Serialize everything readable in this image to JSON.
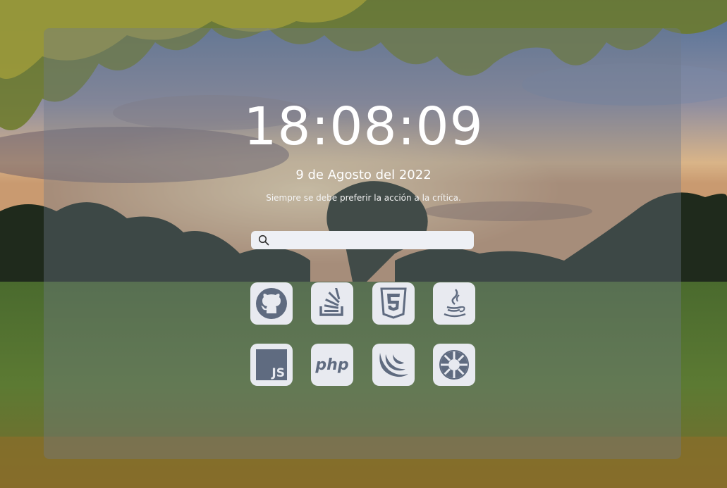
{
  "clock": {
    "time": "18:08:09"
  },
  "date": {
    "text": "9 de Agosto del 2022"
  },
  "quote": {
    "text": "Siempre se debe preferir la acción a la crítica."
  },
  "search": {
    "placeholder": "",
    "value": ""
  },
  "shortcuts": [
    {
      "name": "github",
      "icon": "github-icon"
    },
    {
      "name": "stackoverflow",
      "icon": "stackoverflow-icon"
    },
    {
      "name": "html5",
      "icon": "html5-icon"
    },
    {
      "name": "java",
      "icon": "java-icon"
    },
    {
      "name": "javascript",
      "icon": "javascript-icon",
      "label": "JS"
    },
    {
      "name": "php",
      "icon": "php-icon",
      "label": "php"
    },
    {
      "name": "jquery",
      "icon": "jquery-icon"
    },
    {
      "name": "openshift",
      "icon": "openshift-icon"
    }
  ],
  "colors": {
    "icon": "#5f6b80",
    "tile": "#e8eaf0",
    "text": "#ffffff"
  }
}
